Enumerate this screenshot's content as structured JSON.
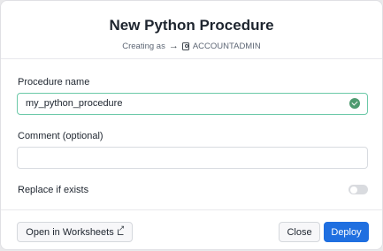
{
  "dialog": {
    "title": "New Python Procedure",
    "creating_as_label": "Creating as",
    "role": "ACCOUNTADMIN"
  },
  "form": {
    "procedure_name": {
      "label": "Procedure name",
      "value": "my_python_procedure",
      "valid": true
    },
    "comment": {
      "label": "Comment (optional)",
      "value": "",
      "placeholder": ""
    },
    "replace_if_exists": {
      "label": "Replace if exists",
      "checked": false
    }
  },
  "footer": {
    "open_worksheets_label": "Open in Worksheets",
    "close_label": "Close",
    "deploy_label": "Deploy"
  },
  "colors": {
    "primary": "#1f6fe0",
    "valid_border": "#6cc9a8",
    "valid_check": "#4e9a6f"
  }
}
